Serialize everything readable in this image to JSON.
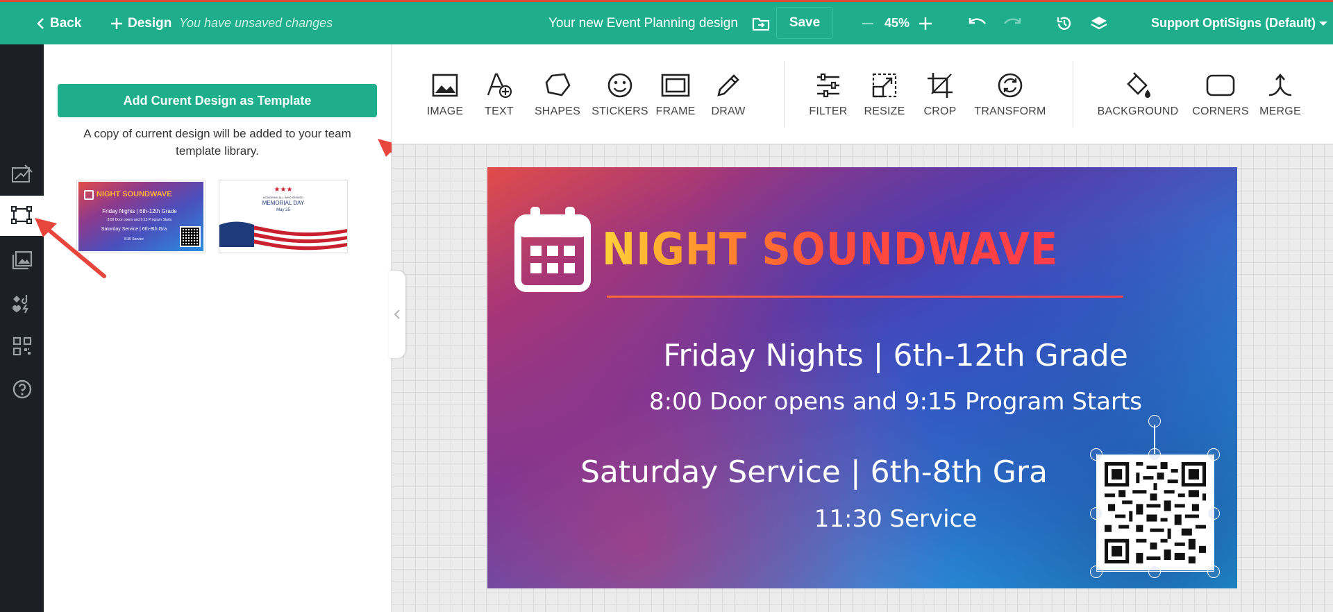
{
  "header": {
    "back_label": "Back",
    "design_label": "Design",
    "unsaved_text": "You have unsaved changes",
    "doc_title": "Your new Event Planning design",
    "save_label": "Save",
    "zoom_value": "45%",
    "account_label": "Support OptiSigns (Default)"
  },
  "panel": {
    "add_template_label": "Add Curent Design as Template",
    "copy_note": "A copy of current design will be added to your team template library.",
    "thumb1": {
      "title": "NIGHT SOUNDWAVE",
      "line1": "Friday Nights | 6th-12th Grade",
      "line2": "8:00 Door opens and 9:15 Program Starts",
      "line3": "Saturday Service | 6th-8th Gra",
      "line4": "8:30 Service"
    },
    "thumb2": {
      "top_text": "HONORING ALL WHO SERVED",
      "title": "MEMORIAL DAY",
      "date": "May 25"
    }
  },
  "toolbar": {
    "tools": [
      "IMAGE",
      "TEXT",
      "SHAPES",
      "STICKERS",
      "FRAME",
      "DRAW",
      "FILTER",
      "RESIZE",
      "CROP",
      "TRANSFORM",
      "BACKGROUND",
      "CORNERS",
      "MERGE"
    ]
  },
  "design": {
    "title": "NIGHT SOUNDWAVE",
    "line1": "Friday Nights | 6th-12th Grade",
    "line2": "8:00 Door opens and 9:15 Program Starts",
    "line3": "Saturday Service | 6th-8th Gra",
    "line4": "11:30 Service"
  },
  "colors": {
    "brand": "#1eae8c",
    "nav_bg": "#1c1f24",
    "arrow": "#e8453c",
    "title_gradient_start": "#ffd23a",
    "title_gradient_end": "#ff3d4a"
  },
  "icons": {
    "left_nav": [
      "edit-design-icon",
      "templates-icon",
      "media-icon",
      "apps-icon",
      "qr-code-icon",
      "help-icon"
    ]
  }
}
